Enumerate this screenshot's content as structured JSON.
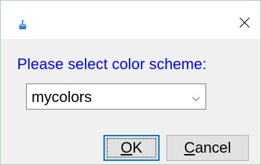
{
  "window": {
    "title": "",
    "icon": "java-cup-icon"
  },
  "titlebar": {
    "close_glyph": "✕"
  },
  "dialog": {
    "prompt": "Please select color scheme:",
    "scheme_select": {
      "selected": "mycolors"
    },
    "buttons": {
      "ok": {
        "mnemonic": "O",
        "rest": "K"
      },
      "cancel": {
        "mnemonic": "C",
        "rest": "ancel"
      }
    }
  },
  "colors": {
    "prompt_text": "#0000ff",
    "client_bg": "#f0f0f0",
    "focus_border": "#0078d7",
    "window_border": "#a7d3a8"
  }
}
